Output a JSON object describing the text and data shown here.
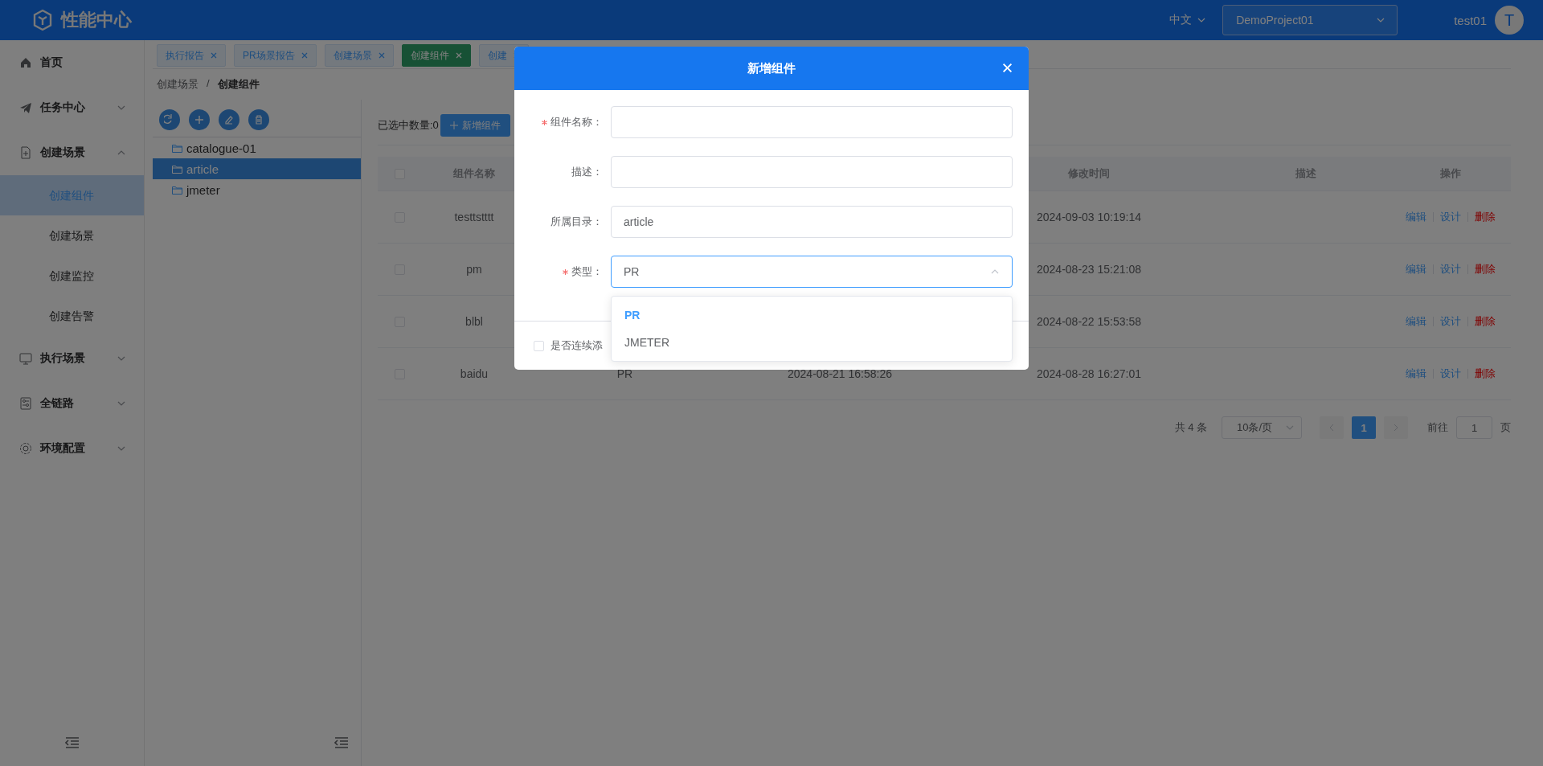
{
  "header": {
    "title": "性能中心",
    "language": "中文",
    "language_open": false,
    "project": "DemoProject01",
    "user": "test01",
    "avatar": "T"
  },
  "sidebar": {
    "items": [
      {
        "kind": "link",
        "label": "首页"
      },
      {
        "kind": "group",
        "label": "任务中心",
        "expanded": false
      },
      {
        "kind": "group",
        "label": "创建场景",
        "expanded": true,
        "children": [
          {
            "label": "创建组件",
            "selected": true
          },
          {
            "label": "创建场景",
            "selected": false
          },
          {
            "label": "创建监控",
            "selected": false
          },
          {
            "label": "创建告警",
            "selected": false
          }
        ]
      },
      {
        "kind": "group",
        "label": "执行场景",
        "expanded": false
      },
      {
        "kind": "group",
        "label": "全链路",
        "expanded": false
      },
      {
        "kind": "group",
        "label": "环境配置",
        "expanded": false
      }
    ]
  },
  "tabs": [
    {
      "label": "执行报告",
      "selected": false
    },
    {
      "label": "PR场景报告",
      "selected": false
    },
    {
      "label": "创建场景",
      "selected": false
    },
    {
      "label": "创建组件",
      "selected": true
    },
    {
      "label": "创建",
      "selected": false
    }
  ],
  "breadcrumb": {
    "items": [
      "创建场景",
      "创建组件"
    ],
    "separator": "/"
  },
  "tree": {
    "items": [
      {
        "label": "catalogue-01",
        "selected": false
      },
      {
        "label": "article",
        "selected": true
      },
      {
        "label": "jmeter",
        "selected": false
      }
    ]
  },
  "toolbar": {
    "selected_count": "已选中数量:0",
    "add_button": "新增组件"
  },
  "table": {
    "all_checked": false,
    "columns": {
      "name": "组件名称",
      "modified": "修改时间",
      "description": "描述",
      "actions": "操作"
    },
    "rows": [
      {
        "checked": false,
        "name": "testtstttt",
        "modified": "2024-09-03 10:19:14",
        "actions": [
          "编辑",
          "设计",
          "删除"
        ]
      },
      {
        "checked": false,
        "name": "pm",
        "modified": "2024-08-23 15:21:08",
        "actions": [
          "编辑",
          "设计",
          "删除"
        ]
      },
      {
        "checked": false,
        "name": "blbl",
        "modified": "2024-08-22 15:53:58",
        "actions": [
          "编辑",
          "设计",
          "删除"
        ]
      },
      {
        "checked": false,
        "name": "baidu",
        "type": "PR",
        "created": "2024-08-21 16:58:26",
        "modified": "2024-08-28 16:27:01",
        "actions": [
          "编辑",
          "设计",
          "删除"
        ]
      }
    ]
  },
  "pagination": {
    "total": "共 4 条",
    "page_size": "10条/页",
    "pages": [
      {
        "label": "1",
        "selected": true
      }
    ],
    "goto_label": "前往",
    "goto_value": "1",
    "goto_suffix": "页"
  },
  "dialog": {
    "title": "新增组件",
    "fields": [
      {
        "kind": "input",
        "label": "组件名称：",
        "required": true
      },
      {
        "kind": "input",
        "label": "描述：",
        "required": false
      },
      {
        "kind": "input",
        "label": "所属目录：",
        "required": false,
        "value": "article"
      },
      {
        "kind": "select",
        "label": "类型：",
        "required": true,
        "value": "PR",
        "open": true,
        "options": [
          {
            "label": "PR",
            "selected": true
          },
          {
            "label": "JMETER",
            "selected": false
          }
        ]
      }
    ],
    "continuous": {
      "label": "是否连续添",
      "checked": false
    }
  }
}
